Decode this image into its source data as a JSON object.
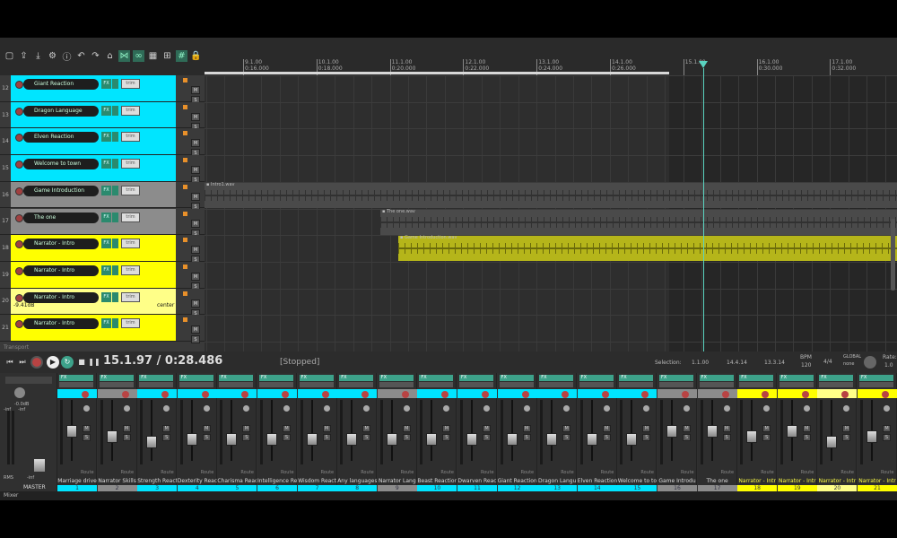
{
  "toolbar": {
    "icons": [
      "new-file-icon",
      "open-icon",
      "save-icon",
      "settings-icon",
      "info-icon",
      "undo-icon",
      "redo-icon",
      "home-icon",
      "ripple-icon",
      "link-icon",
      "grid-icon",
      "snap-icon",
      "grid-lines-icon",
      "lock-icon"
    ]
  },
  "ruler": {
    "marks": [
      {
        "bar": "9.1.00",
        "time": "0:16.000"
      },
      {
        "bar": "10.1.00",
        "time": "0:18.000"
      },
      {
        "bar": "11.1.00",
        "time": "0:20.000"
      },
      {
        "bar": "12.1.00",
        "time": "0:22.000"
      },
      {
        "bar": "13.1.00",
        "time": "0:24.000"
      },
      {
        "bar": "14.1.00",
        "time": "0:26.000"
      },
      {
        "bar": "15.1.00",
        "time": ""
      },
      {
        "bar": "16.1.00",
        "time": "0:30.000"
      },
      {
        "bar": "17.1.00",
        "time": "0:32.000"
      }
    ]
  },
  "tracks": [
    {
      "num": "12",
      "name": "Giant Reaction",
      "color": "#00e5ff",
      "fx": "FX",
      "trim": "trim"
    },
    {
      "num": "13",
      "name": "Dragon Language",
      "color": "#00e5ff",
      "fx": "FX",
      "trim": "trim"
    },
    {
      "num": "14",
      "name": "Elven Reaction",
      "color": "#00e5ff",
      "fx": "FX",
      "trim": "trim"
    },
    {
      "num": "15",
      "name": "Welcome to town",
      "color": "#00e5ff",
      "fx": "FX",
      "trim": "trim"
    },
    {
      "num": "16",
      "name": "Game Introduction",
      "color": "#8c8c8c",
      "fx": "FX",
      "trim": "trim"
    },
    {
      "num": "17",
      "name": "The one",
      "color": "#8c8c8c",
      "fx": "FX",
      "trim": "trim"
    },
    {
      "num": "18",
      "name": "Narrator - Intro",
      "color": "#ffff00",
      "fx": "FX",
      "trim": "trim"
    },
    {
      "num": "19",
      "name": "Narrator - Intro",
      "color": "#ffff00",
      "fx": "FX",
      "trim": "trim"
    },
    {
      "num": "20",
      "name": "Narrator - Intro",
      "color": "#ffff88",
      "fx": "FX",
      "trim": "trim",
      "vol": "-9.41dB",
      "pan": "center"
    },
    {
      "num": "21",
      "name": "Narrator - Intro",
      "color": "#ffff00",
      "fx": "FX",
      "trim": "trim"
    }
  ],
  "items": [
    {
      "label": "Intro1.wav",
      "color": "#4a4a4a"
    },
    {
      "label": "The one.wav",
      "color": "#4a4a4a"
    },
    {
      "label": "Game Introduction.wav",
      "color": "#b5b51a"
    }
  ],
  "transport": {
    "label": "Transport",
    "position": "15.1.97 / 0:28.486",
    "status": "[Stopped]",
    "selection_label": "Selection:",
    "sel_start": "1.1.00",
    "sel_end": "14.4.14",
    "sel_len": "13.3.14",
    "bpm_label": "BPM",
    "bpm": "120",
    "timesig": "4/4",
    "global_label": "GLOBAL",
    "global_value": "none",
    "rate_label": "Rate:",
    "rate": "1.0"
  },
  "master": {
    "label": "MASTER",
    "rms": "RMS",
    "inf1": "-inf",
    "inf2": "-inf",
    "db": "-0.0dB"
  },
  "mixer": {
    "tab": "Mixer",
    "fx_label": "FX",
    "m_label": "M",
    "s_label": "S",
    "route_label": "Route",
    "strips": [
      {
        "name": "Marriage drive",
        "num": "1",
        "color": "#00e5ff",
        "fader": 0.55
      },
      {
        "name": "Narrator Skills",
        "num": "2",
        "color": "#8c8c8c",
        "fader": 0.45
      },
      {
        "name": "Strength React",
        "num": "3",
        "color": "#00e5ff",
        "fader": 0.35
      },
      {
        "name": "Dexterity React",
        "num": "4",
        "color": "#00e5ff",
        "fader": 0.4
      },
      {
        "name": "Charisma React",
        "num": "5",
        "color": "#00e5ff",
        "fader": 0.4
      },
      {
        "name": "Intelligence Re",
        "num": "6",
        "color": "#00e5ff",
        "fader": 0.4
      },
      {
        "name": "Wisdom React",
        "num": "7",
        "color": "#00e5ff",
        "fader": 0.4
      },
      {
        "name": "Any languages",
        "num": "8",
        "color": "#00e5ff",
        "fader": 0.4
      },
      {
        "name": "Narrator Lang",
        "num": "9",
        "color": "#8c8c8c",
        "fader": 0.4
      },
      {
        "name": "Beast Reaction",
        "num": "10",
        "color": "#00e5ff",
        "fader": 0.4
      },
      {
        "name": "Dwarven Reac",
        "num": "11",
        "color": "#00e5ff",
        "fader": 0.4
      },
      {
        "name": "Giant Reaction",
        "num": "12",
        "color": "#00e5ff",
        "fader": 0.4
      },
      {
        "name": "Dragon Langu",
        "num": "13",
        "color": "#00e5ff",
        "fader": 0.4
      },
      {
        "name": "Elven Reaction",
        "num": "14",
        "color": "#00e5ff",
        "fader": 0.4
      },
      {
        "name": "Welcome to to",
        "num": "15",
        "color": "#00e5ff",
        "fader": 0.4
      },
      {
        "name": "Game Introdu",
        "num": "16",
        "color": "#8c8c8c",
        "fader": 0.55
      },
      {
        "name": "The one",
        "num": "17",
        "color": "#8c8c8c",
        "fader": 0.55
      },
      {
        "name": "Narrator - Intr",
        "num": "18",
        "color": "#ffff00",
        "fader": 0.45
      },
      {
        "name": "Narrator - Intr",
        "num": "19",
        "color": "#ffff00",
        "fader": 0.55
      },
      {
        "name": "Narrator - Intr",
        "num": "20",
        "color": "#ffff88",
        "fader": 0.35
      },
      {
        "name": "Narrator - Intr",
        "num": "21",
        "color": "#ffff00",
        "fader": 0.45
      }
    ]
  }
}
